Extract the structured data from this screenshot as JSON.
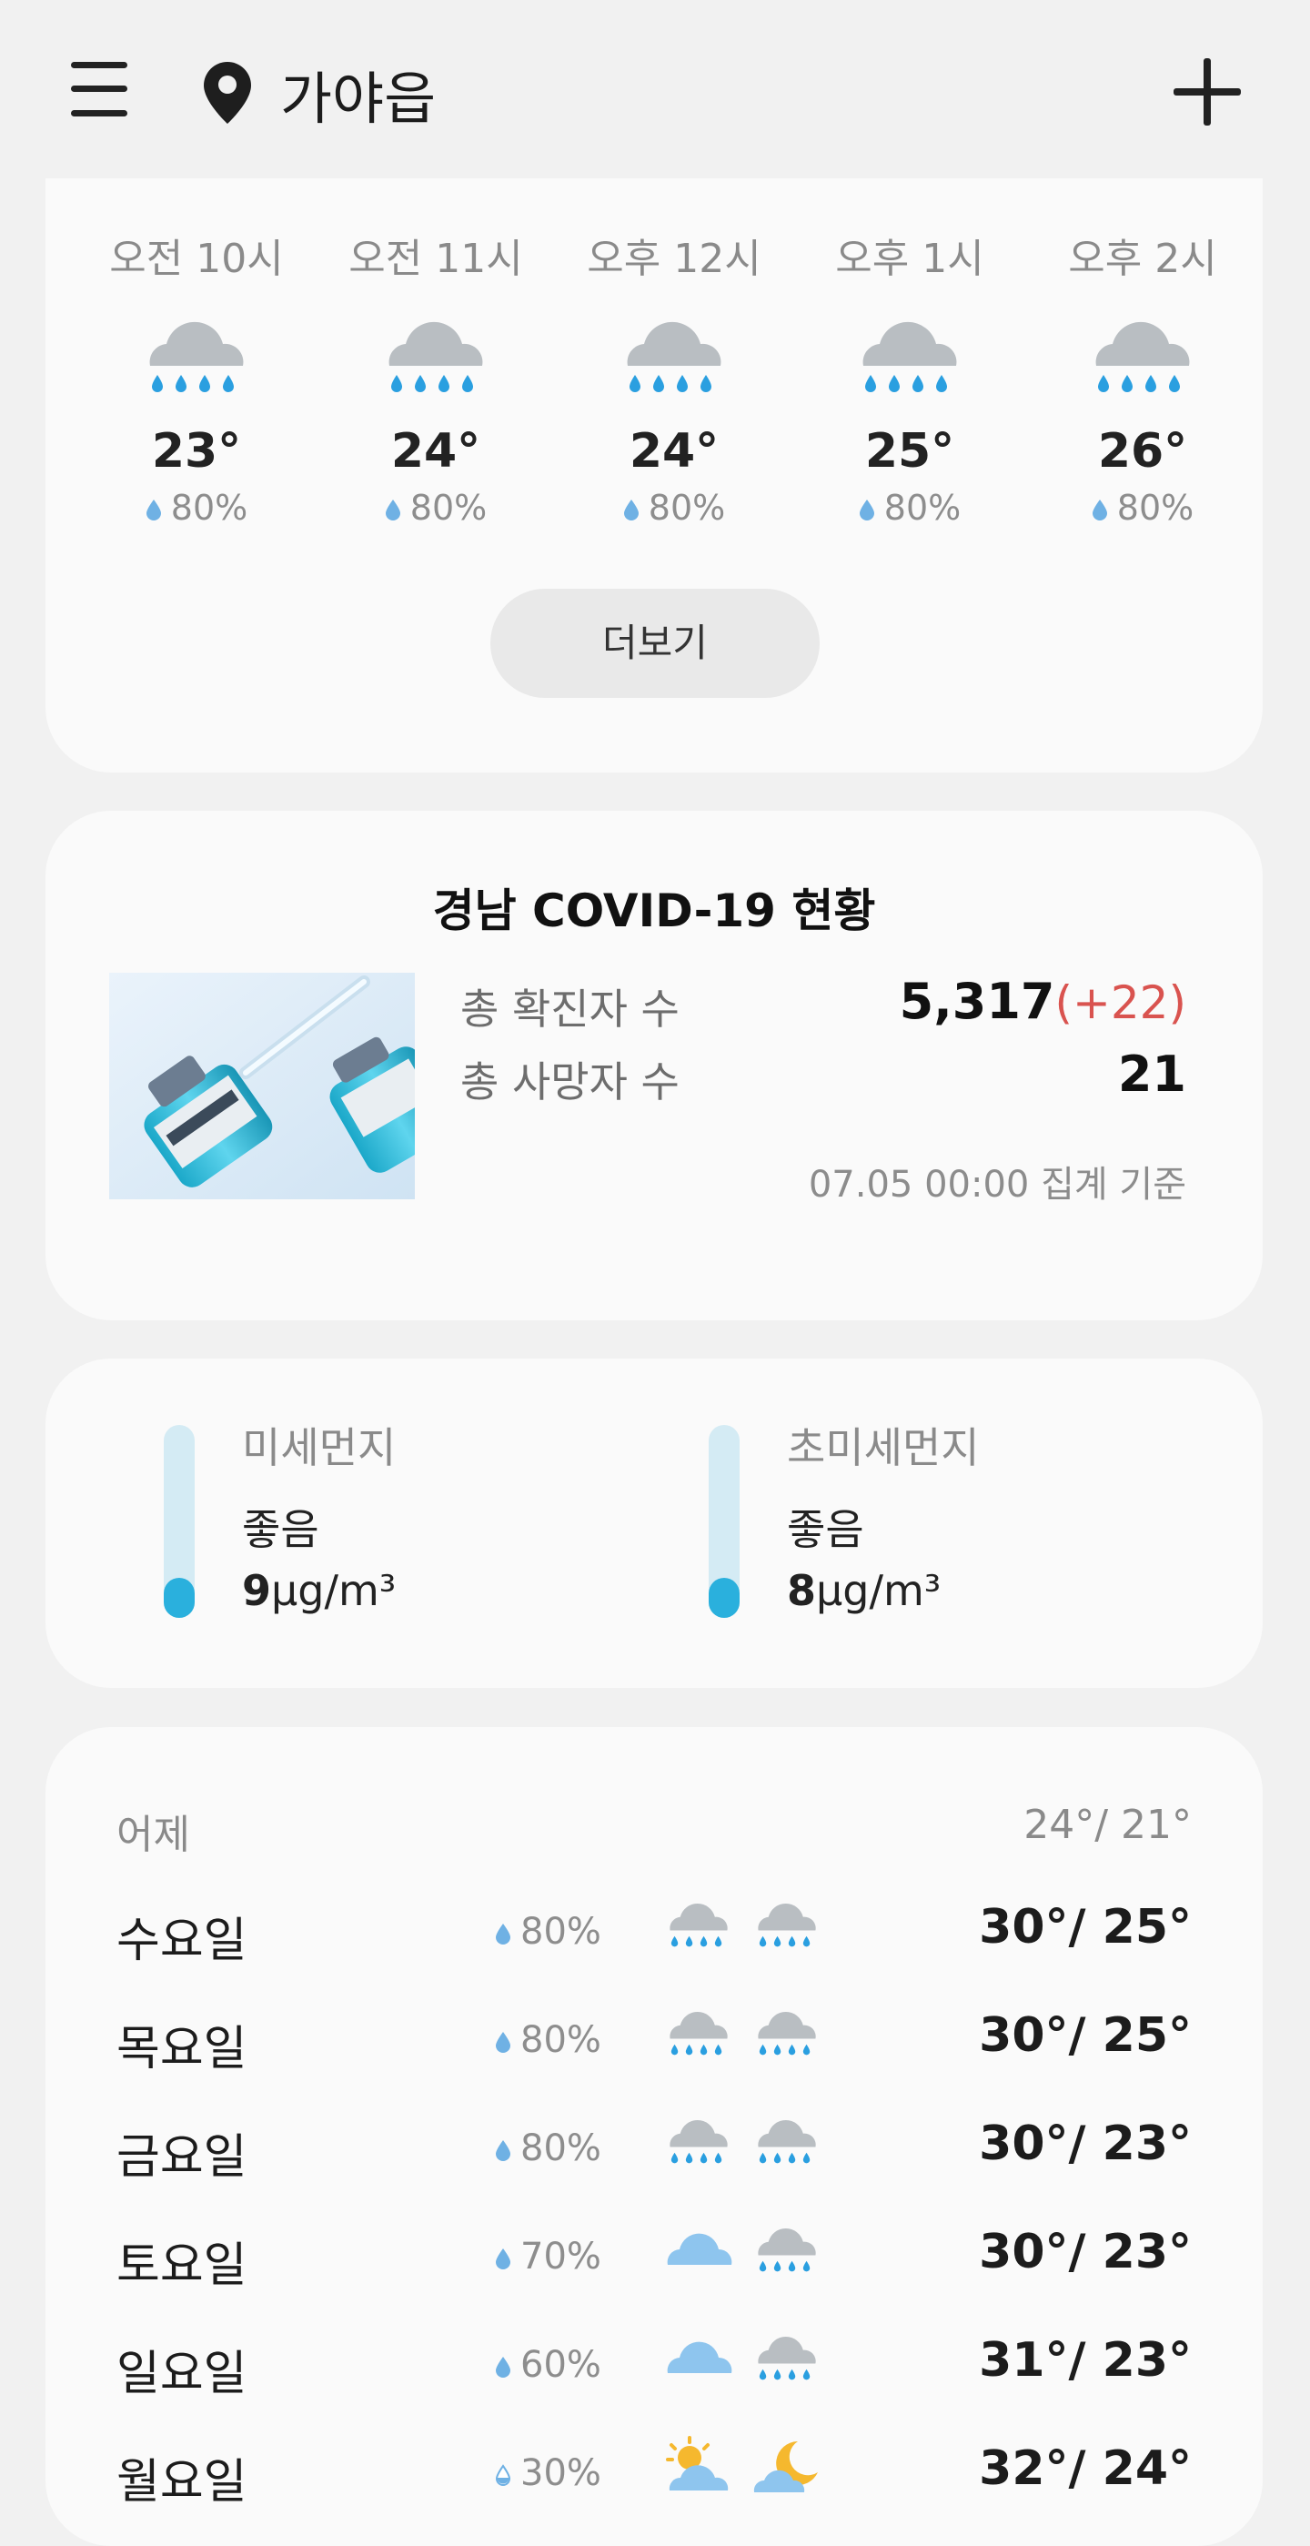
{
  "header": {
    "location": "가야읍"
  },
  "hourly": [
    {
      "time": "오전 10시",
      "temp": "23°",
      "pop": "80%",
      "icon": "rain-cloud-icon"
    },
    {
      "time": "오전 11시",
      "temp": "24°",
      "pop": "80%",
      "icon": "rain-cloud-icon"
    },
    {
      "time": "오후 12시",
      "temp": "24°",
      "pop": "80%",
      "icon": "rain-cloud-icon"
    },
    {
      "time": "오후 1시",
      "temp": "25°",
      "pop": "80%",
      "icon": "rain-cloud-icon"
    },
    {
      "time": "오후 2시",
      "temp": "26°",
      "pop": "80%",
      "icon": "rain-cloud-icon"
    }
  ],
  "more_label": "더보기",
  "covid": {
    "title": "경남 COVID-19 현황",
    "confirmed_label": "총 확진자 수",
    "confirmed_value": "5,317",
    "confirmed_delta": "(+22)",
    "deaths_label": "총 사망자 수",
    "deaths_value": "21",
    "stamp": "07.05 00:00 집계 기준"
  },
  "dust": [
    {
      "label": "미세먼지",
      "status": "좋음",
      "value": "9",
      "unit": "μg/m³",
      "level": 0.2
    },
    {
      "label": "초미세먼지",
      "status": "좋음",
      "value": "8",
      "unit": "μg/m³",
      "level": 0.2
    }
  ],
  "weekly": {
    "yesterday_label": "어제",
    "yesterday_temp": "24°/ 21°",
    "days": [
      {
        "name": "수요일",
        "pop": "80%",
        "am_icon": "rain-cloud-icon",
        "pm_icon": "rain-cloud-icon",
        "temp": "30°/ 25°"
      },
      {
        "name": "목요일",
        "pop": "80%",
        "am_icon": "rain-cloud-icon",
        "pm_icon": "rain-cloud-icon",
        "temp": "30°/ 25°"
      },
      {
        "name": "금요일",
        "pop": "80%",
        "am_icon": "rain-cloud-icon",
        "pm_icon": "rain-cloud-icon",
        "temp": "30°/ 23°"
      },
      {
        "name": "토요일",
        "pop": "70%",
        "am_icon": "cloud-icon",
        "pm_icon": "rain-cloud-icon",
        "temp": "30°/ 23°"
      },
      {
        "name": "일요일",
        "pop": "60%",
        "am_icon": "cloud-icon",
        "pm_icon": "rain-cloud-icon",
        "temp": "31°/ 23°"
      },
      {
        "name": "월요일",
        "pop": "30%",
        "am_icon": "partly-sunny-icon",
        "pm_icon": "partly-cloudy-night-icon",
        "temp": "32°/ 24°"
      }
    ]
  },
  "colors": {
    "accent": "#2ab0dd",
    "cloud_gray": "#b9bec2",
    "rain_blue": "#2a9fe0",
    "delta_red": "#d9534f"
  }
}
